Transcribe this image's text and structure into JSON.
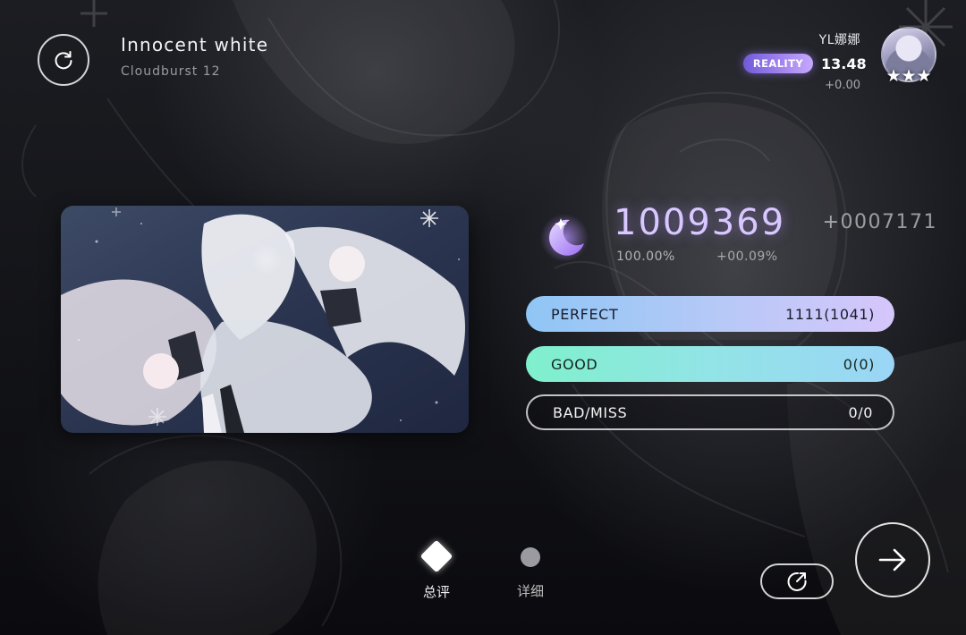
{
  "song": {
    "title": "Innocent white",
    "difficulty": "Cloudburst 12"
  },
  "player": {
    "name": "YL娜娜",
    "rank_badge": "REALITY",
    "rating": "13.48",
    "rating_delta": "+0.00",
    "stars": "★★★"
  },
  "result": {
    "score": "1009369",
    "score_delta": "+0007171",
    "accuracy": "100.00%",
    "accuracy_delta": "+00.09%",
    "grade_icon": "crescent-moon-icon"
  },
  "judgements": [
    {
      "label": "PERFECT",
      "value": "1111(1041)"
    },
    {
      "label": "GOOD",
      "value": "0(0)"
    },
    {
      "label": "BAD/MISS",
      "value": "0/0"
    }
  ],
  "nav": {
    "tabs": [
      {
        "label": "总评",
        "active": true
      },
      {
        "label": "详细",
        "active": false
      }
    ]
  },
  "buttons": {
    "retry_icon": "retry-icon",
    "share_icon": "share-icon",
    "next_icon": "arrow-right-icon"
  },
  "colors": {
    "perfect_bar": "#b8c9f7",
    "good_bar": "#92e4e6",
    "score_glow": "#d9c8ff",
    "reality_badge": "#8f72e6"
  }
}
